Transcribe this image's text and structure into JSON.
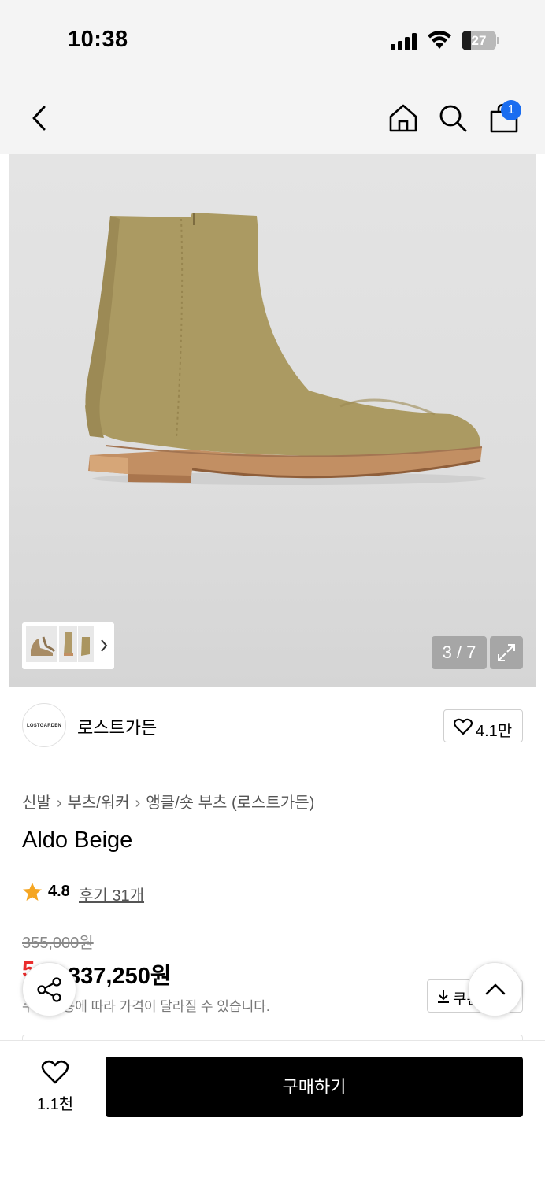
{
  "status": {
    "time": "10:38",
    "battery": "27",
    "battery_level": 0.27
  },
  "header": {
    "cart_badge": "1"
  },
  "gallery": {
    "counter": "3 / 7"
  },
  "brand": {
    "logo_text": "LOSTGARDEN",
    "name": "로스트가든",
    "likes": "4.1만"
  },
  "breadcrumb": {
    "items": [
      "신발",
      "부츠/워커",
      "앵클/숏 부츠 (로스트가든)"
    ]
  },
  "product": {
    "title": "Aldo Beige"
  },
  "rating": {
    "score": "4.8",
    "reviews": "후기 31개"
  },
  "price": {
    "original": "355,000원",
    "discount": "5",
    "sale": "337,250원",
    "note": "쿠폰 적용에 따라 가격이 달라질 수 있습니다.",
    "coupon_label": "쿠폰"
  },
  "bottom": {
    "like_count": "1.1천",
    "buy_label": "구매하기"
  },
  "colors": {
    "accent_red": "#ea2d2d",
    "badge_blue": "#1a6df0",
    "buy_button": "#000000"
  }
}
